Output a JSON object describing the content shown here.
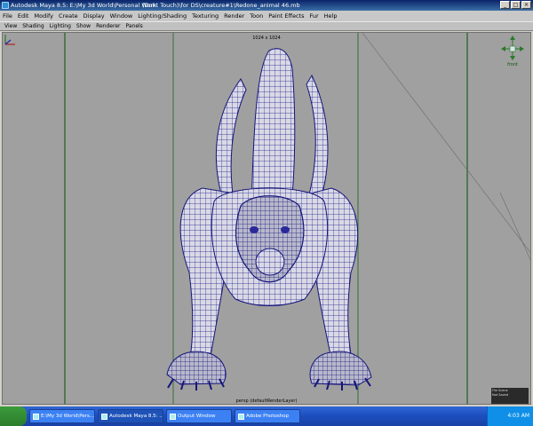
{
  "window": {
    "title_left": "Autodesk Maya 8.5: E:\\My 3d World\\Personal Work",
    "title_right": "(Dont Touch)\\for DS\\creature#1\\Redone_animal 46.mb"
  },
  "menubar": [
    "File",
    "Edit",
    "Modify",
    "Create",
    "Display",
    "Window",
    "Lighting/Shading",
    "Texturing",
    "Render",
    "Toon",
    "Paint Effects",
    "Fur",
    "Help"
  ],
  "panel_menu": [
    "View",
    "Shading",
    "Lighting",
    "Show",
    "Renderer",
    "Panels"
  ],
  "viewport": {
    "resolution": "1024 x 1024",
    "camera": "persp (defaultRenderLayer)",
    "view_cube_label": "front",
    "corner_info": [
      "File Scene",
      "Not Saved"
    ]
  },
  "taskbar": {
    "tasks": [
      {
        "label": "E:\\My 3d World\\Pers...",
        "icon": "folder-icon"
      },
      {
        "label": "Autodesk Maya 8.5: ...",
        "icon": "maya-icon"
      },
      {
        "label": "Output Window",
        "icon": "window-icon"
      },
      {
        "label": "Adobe Photoshop",
        "icon": "photoshop-icon"
      }
    ],
    "clock": "4:03 AM"
  },
  "colors": {
    "viewport_bg": "#a0a0a0",
    "wire": "#1a1a8a",
    "mesh": "#d8d8e4",
    "guide": "#1f5f1f"
  }
}
